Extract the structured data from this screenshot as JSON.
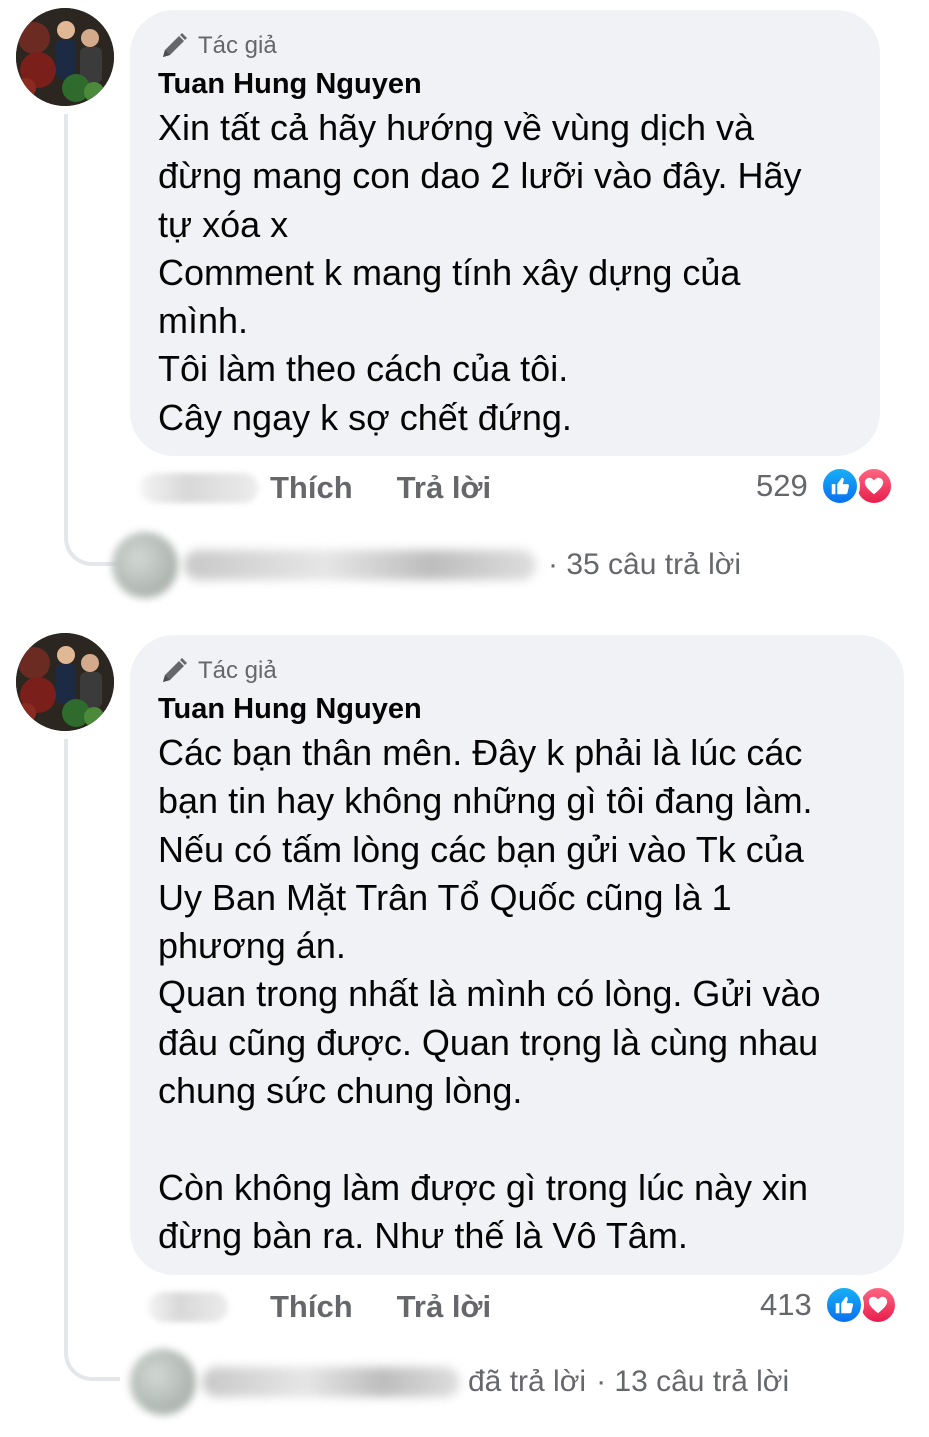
{
  "theme": {
    "bubble_bg": "#f0f2f5",
    "secondary_text": "#65676b",
    "like_blue": "#0a6ff0",
    "love_red": "#e61e4d"
  },
  "comments": [
    {
      "author_badge": "Tác giả",
      "author_name": "Tuan Hung Nguyen",
      "text": "Xin tất cả hãy hướng về vùng dịch và\nđừng mang con dao 2 lưỡi vào đây. Hãy\ntự xóa x\nComment k mang tính xây dựng của\nmình.\nTôi làm theo cách của tôi.\nCây ngay k sợ chết đứng.",
      "like_label": "Thích",
      "reply_label": "Trả lời",
      "reaction_count": "529",
      "reaction_icons": [
        "like-icon",
        "love-icon"
      ],
      "replies_prefix": "",
      "replies_summary": "· 35 câu trả lời"
    },
    {
      "author_badge": "Tác giả",
      "author_name": "Tuan Hung Nguyen",
      "text": "Các bạn thân mên. Đây k phải là lúc các\nbạn tin hay không những gì tôi đang làm.\nNếu có tấm lòng các bạn gửi vào Tk của\nUy Ban Mặt Trân Tổ Quốc cũng là 1\nphương án.\nQuan trong nhất là mình có lòng. Gửi vào\nđâu cũng được. Quan trọng là cùng nhau\nchung sức chung lòng.\n\nCòn không làm được gì trong lúc này xin\nđừng bàn ra. Như thế là Vô Tâm.",
      "like_label": "Thích",
      "reply_label": "Trả lời",
      "reaction_count": "413",
      "reaction_icons": [
        "like-icon",
        "love-icon"
      ],
      "replies_prefix": "đã trả lời",
      "replies_summary": "· 13 câu trả lời"
    }
  ]
}
